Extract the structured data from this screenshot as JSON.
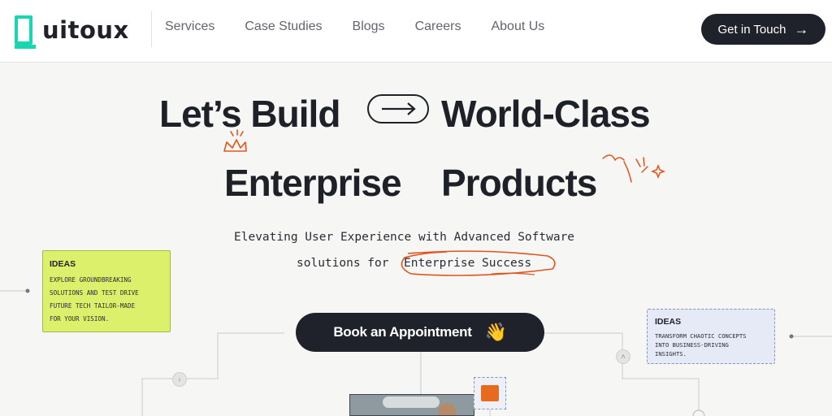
{
  "nav": {
    "logo_text": "uitoux",
    "links": [
      "Services",
      "Case Studies",
      "Blogs",
      "Careers",
      "About Us"
    ],
    "cta_label": "Get in Touch",
    "cta_icon": "arrow-right-icon"
  },
  "hero": {
    "line1_a": "Let’s Build",
    "line1_b": "World-Class",
    "line2_a": "Enterprise",
    "line2_b": "Products",
    "sub_line1": "Elevating User Experience with Advanced Software",
    "sub_line2_prefix": "solutions for",
    "sub_line2_highlight": "Enterprise Success"
  },
  "cards": [
    {
      "title": "IDEAS",
      "text": "EXPLORE GROUNDBREAKING\nSOLUTIONS AND TEST DRIVE\nFUTURE TECH TAILOR-MADE\nFOR YOUR VISION."
    },
    {
      "title": "IDEAS",
      "text": "TRANSFORM CHAOTIC CONCEPTS\nINTO BUSINESS-DRIVING\nINSIGHTS."
    }
  ],
  "book_button": {
    "label": "Book an Appointment",
    "emoji": "👋"
  },
  "colors": {
    "brand_teal": "#18d6b0",
    "dark": "#1f222a",
    "accent_orange": "#e0551e",
    "card_yellow": "#dcf06c",
    "card_blue": "#e6e9f6"
  }
}
